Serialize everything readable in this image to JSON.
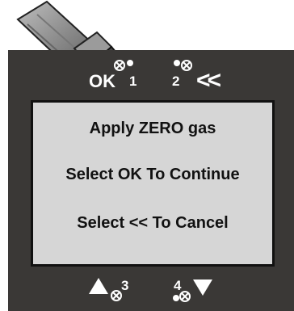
{
  "buttons": {
    "ok_label": "OK",
    "button1_number": "1",
    "button2_number": "2",
    "back_label": "<<",
    "button3_number": "3",
    "button4_number": "4"
  },
  "screen": {
    "line1": "Apply ZERO gas",
    "line2": "Select OK To Continue",
    "line3": "Select << To Cancel"
  },
  "icons": {
    "probe": "gas-probe-icon",
    "magnet_target": "magnet-target-icon",
    "up": "up-arrow-icon",
    "down": "down-arrow-icon"
  },
  "colors": {
    "panel": "#3a3836",
    "screen": "#d6d6d6",
    "text_light": "#ffffff",
    "text_dark": "#111111"
  }
}
